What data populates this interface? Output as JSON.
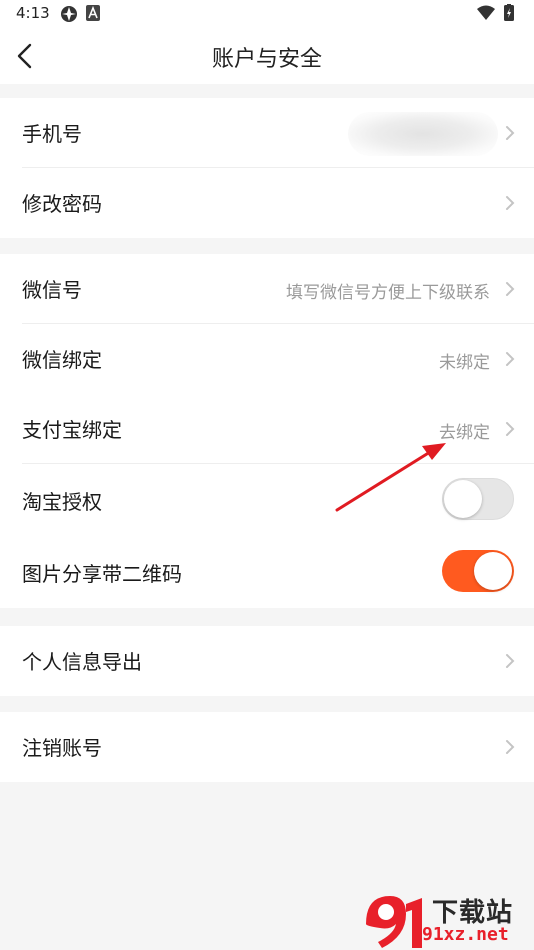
{
  "status_bar": {
    "time": "4:13",
    "left_icons": [
      "app-logo-icon",
      "a-badge-icon"
    ],
    "right_icons": [
      "wifi-icon",
      "battery-icon"
    ]
  },
  "nav": {
    "title": "账户与安全",
    "back_icon": "chevron-left-icon"
  },
  "groups": [
    {
      "rows": [
        {
          "label": "手机号",
          "value": "",
          "value_blurred": true
        },
        {
          "label": "修改密码"
        }
      ]
    },
    {
      "rows": [
        {
          "label": "微信号",
          "value": "填写微信号方便上下级联系"
        },
        {
          "label": "微信绑定",
          "value": "未绑定"
        },
        {
          "label": "支付宝绑定",
          "value": "去绑定"
        },
        {
          "label": "淘宝授权",
          "toggle": false
        },
        {
          "label": "图片分享带二维码",
          "toggle": true
        }
      ]
    },
    {
      "rows": [
        {
          "label": "个人信息导出"
        }
      ]
    },
    {
      "rows": [
        {
          "label": "注销账号"
        }
      ]
    }
  ],
  "watermark": {
    "logo_text": "9f",
    "title": "下载站",
    "domain": "91xz.net"
  },
  "colors": {
    "accent": "#ff5a1f",
    "annotation_arrow": "#e01b22",
    "page_background": "#f5f5f5"
  }
}
